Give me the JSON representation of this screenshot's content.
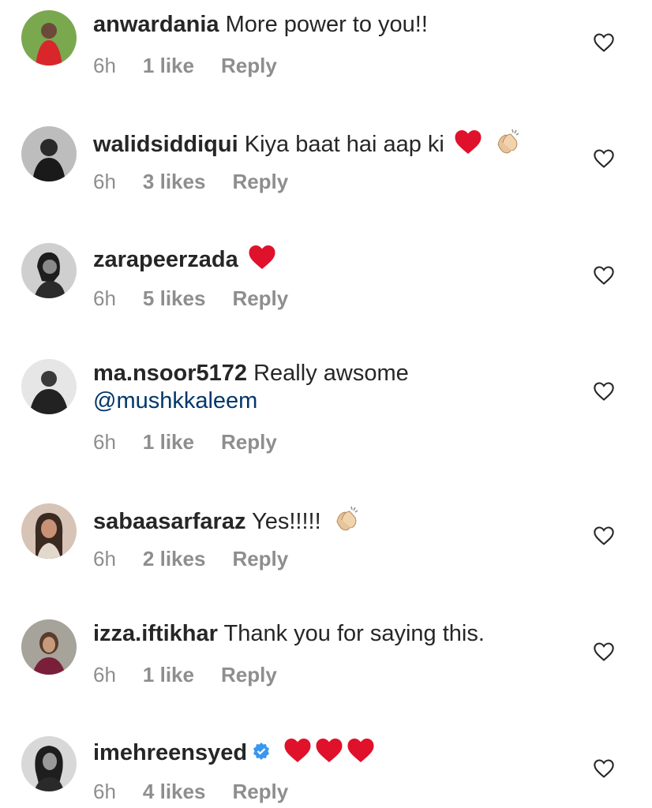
{
  "colors": {
    "text": "#262626",
    "meta": "#8e8e8e",
    "mention": "#00376b",
    "heart": "#e0112b",
    "verified": "#3897f0"
  },
  "comments": [
    {
      "username": "anwardania",
      "text": "More power to you!!",
      "time": "6h",
      "likes": "1 like",
      "reply": "Reply",
      "emojis": []
    },
    {
      "username": "walidsiddiqui",
      "text": "Kiya baat hai aap ki",
      "time": "6h",
      "likes": "3 likes",
      "reply": "Reply",
      "emojis": [
        "red-heart",
        "clapping-hands"
      ]
    },
    {
      "username": "zarapeerzada",
      "text": "",
      "time": "6h",
      "likes": "5 likes",
      "reply": "Reply",
      "emojis": [
        "red-heart"
      ]
    },
    {
      "username": "ma.nsoor5172",
      "text": "Really awsome",
      "mention": "@mushkkaleem",
      "time": "6h",
      "likes": "1 like",
      "reply": "Reply",
      "emojis": []
    },
    {
      "username": "sabaasarfaraz",
      "text": "Yes!!!!!",
      "time": "6h",
      "likes": "2 likes",
      "reply": "Reply",
      "emojis": [
        "clapping-hands"
      ]
    },
    {
      "username": "izza.iftikhar",
      "text": "Thank you for saying this.",
      "time": "6h",
      "likes": "1 like",
      "reply": "Reply",
      "emojis": []
    },
    {
      "username": "imehreensyed",
      "text": "",
      "time": "6h",
      "likes": "4 likes",
      "reply": "Reply",
      "verified": true,
      "emojis": [
        "red-heart",
        "red-heart",
        "red-heart"
      ]
    }
  ]
}
